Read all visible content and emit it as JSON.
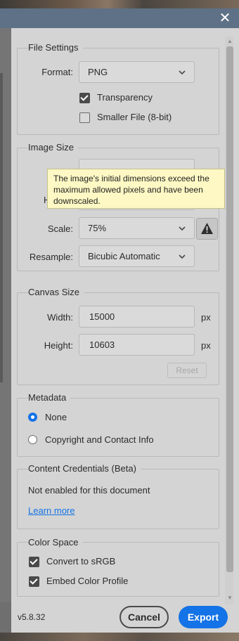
{
  "dialog": {
    "close_icon": "close-icon",
    "version": "v5.8.32",
    "cancel_label": "Cancel",
    "export_label": "Export",
    "accent_color": "#1473e6"
  },
  "file_settings": {
    "title": "File Settings",
    "format_label": "Format:",
    "format_value": "PNG",
    "transparency_label": "Transparency",
    "transparency_checked": true,
    "smaller_file_label": "Smaller File (8-bit)",
    "smaller_file_checked": false
  },
  "image_size": {
    "title": "Image Size",
    "tooltip": "The image's initial dimensions exceed the maximum allowed pixels and have been downscaled.",
    "scale_label": "Scale:",
    "scale_value": "75%",
    "resample_label": "Resample:",
    "resample_value": "Bicubic Automatic",
    "warning_icon": "warning-icon"
  },
  "canvas_size": {
    "title": "Canvas Size",
    "width_label": "Width:",
    "width_value": "15000",
    "height_label": "Height:",
    "height_value": "10603",
    "unit": "px",
    "reset_label": "Reset"
  },
  "metadata": {
    "title": "Metadata",
    "options": [
      "None",
      "Copyright and Contact Info"
    ],
    "selected": "None"
  },
  "content_credentials": {
    "title": "Content Credentials (Beta)",
    "status": "Not enabled for this document",
    "learn_more": "Learn more"
  },
  "color_space": {
    "title": "Color Space",
    "convert_label": "Convert to sRGB",
    "convert_checked": true,
    "embed_label": "Embed Color Profile",
    "embed_checked": true
  }
}
